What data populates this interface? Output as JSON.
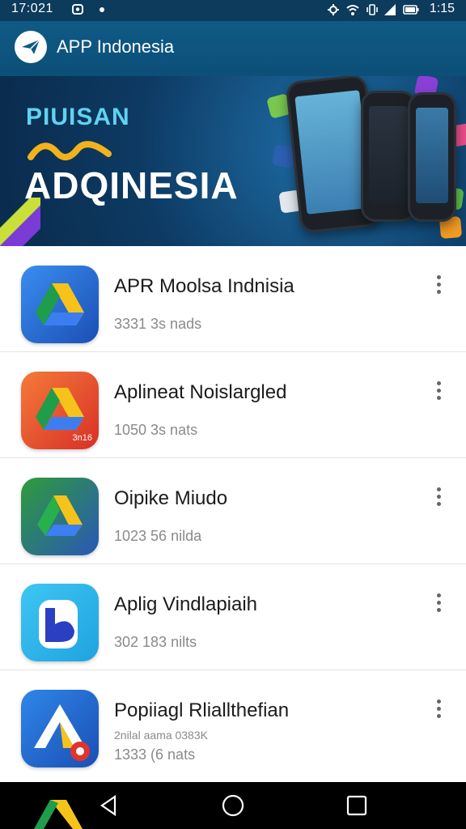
{
  "status_bar": {
    "time_left": "17:021",
    "time_right": "1:15"
  },
  "app_bar": {
    "title": "APP Indonesia",
    "logo_icon": "paper-plane-icon"
  },
  "banner": {
    "line1": "PIUISAN",
    "line2": "ADQINESIA"
  },
  "apps": [
    {
      "name": "APR Moolsa Indnisia",
      "meta": "3331 3s nads",
      "icon": "drive-icon-blue"
    },
    {
      "name": "Aplineat Noislargled",
      "meta": "1050 3s nats",
      "icon": "drive-icon-red",
      "badge": "3n16"
    },
    {
      "name": "Oipike Miudo",
      "meta": "1023 56 nilda",
      "icon": "drive-icon-green"
    },
    {
      "name": "Aplig Vindlapiaih",
      "meta": "302 183 nilts",
      "icon": "b-icon-lightblue"
    },
    {
      "name": "Popiiagl Rliallthefian",
      "sub": "2nilal aama 0383K",
      "meta": "1333 (6 nats",
      "icon": "drive-icon-outline"
    }
  ],
  "colors": {
    "status_bar": "#0c3b5c",
    "app_bar": "#0f5a86",
    "banner_dark": "#0a2b4c",
    "banner_text_top": "#5fd3f0",
    "nav_bar": "#000000"
  }
}
